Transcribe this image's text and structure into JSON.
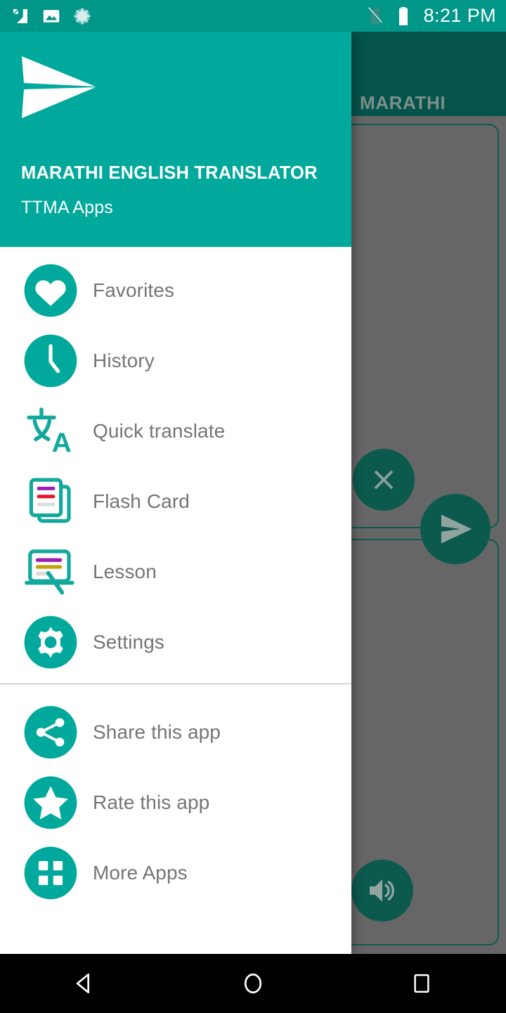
{
  "status_bar": {
    "time": "8:21 PM",
    "left_icons": [
      {
        "name": "screenshot-icon"
      },
      {
        "name": "image-icon"
      },
      {
        "name": "sync-spinner-icon"
      }
    ],
    "right_icons": [
      {
        "name": "no-sim-icon"
      },
      {
        "name": "battery-full-icon"
      }
    ]
  },
  "background_app": {
    "appbar_title": "MARATHI",
    "buttons": [
      {
        "name": "clear-button",
        "icon": "close-icon"
      },
      {
        "name": "translate-button",
        "icon": "send-icon"
      },
      {
        "name": "speak-button",
        "icon": "volume-up-icon"
      }
    ]
  },
  "drawer": {
    "logo_icon": "paper-plane-logo",
    "title": "MARATHI ENGLISH TRANSLATOR",
    "subtitle": "TTMA Apps",
    "primary_items": [
      {
        "label": "Favorites",
        "icon": "heart-icon"
      },
      {
        "label": "History",
        "icon": "clock-icon"
      },
      {
        "label": "Quick translate",
        "icon": "translate-icon"
      },
      {
        "label": "Flash Card",
        "icon": "flash-card-icon"
      },
      {
        "label": "Lesson",
        "icon": "lesson-icon"
      },
      {
        "label": "Settings",
        "icon": "gear-icon"
      }
    ],
    "secondary_items": [
      {
        "label": "Share this app",
        "icon": "share-icon"
      },
      {
        "label": "Rate this app",
        "icon": "star-icon"
      },
      {
        "label": "More Apps",
        "icon": "grid-apps-icon"
      }
    ]
  },
  "system_nav": {
    "back": "Back",
    "home": "Home",
    "recents": "Recent apps"
  },
  "colors": {
    "teal_primary": "#01a99c",
    "teal_status": "#009688",
    "teal_dark": "#04544b",
    "scrim": "#666666",
    "label_gray": "#757575",
    "flash_purple": "#9c1fb5",
    "flash_red": "#e8142d",
    "lesson_yellow": "#bfa50a"
  }
}
